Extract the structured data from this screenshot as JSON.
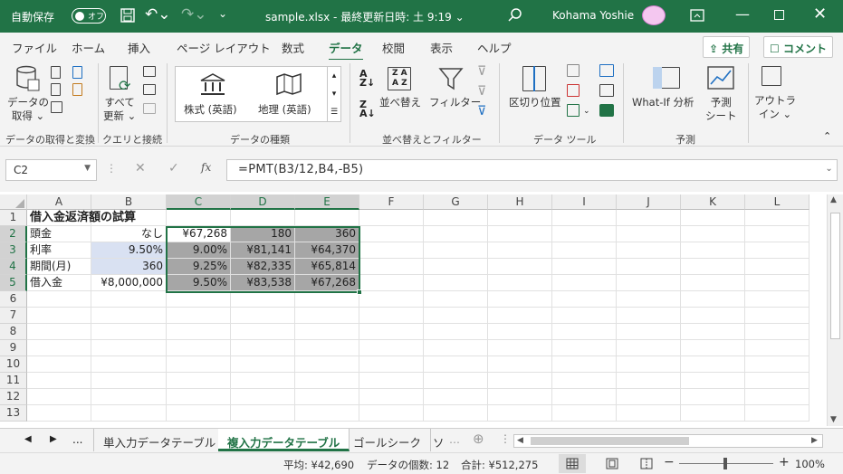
{
  "titlebar": {
    "autosave": "自動保存",
    "toggle": "オフ",
    "filename": "sample.xlsx - 最終更新日時: 土 9:19 ⌄",
    "user": "Kohama Yoshie",
    "colors": {
      "bg": "#217346"
    }
  },
  "menu": {
    "tabs": [
      "ファイル",
      "ホーム",
      "挿入",
      "ページ レイアウト",
      "数式",
      "データ",
      "校閲",
      "表示",
      "ヘルプ"
    ],
    "active": "データ",
    "share": "共有",
    "comment": "コメント"
  },
  "ribbon": {
    "get_data": "データの\n取得 ⌄",
    "refresh_all": "すべて\n更新 ⌄",
    "stocks": "株式 (英語)",
    "geography": "地理 (英語)",
    "sort": "並べ替え",
    "filter": "フィルター",
    "text_to_columns": "区切り位置",
    "whatif": "What-If 分析",
    "forecast": "予測\nシート",
    "outline": "アウトラ\nイン ⌄",
    "groups": [
      "データの取得と変換",
      "クエリと接続",
      "データの種類",
      "並べ替えとフィルター",
      "データ ツール",
      "予測"
    ]
  },
  "formulabar": {
    "namebox": "C2",
    "formula": "=PMT(B3/12,B4,-B5)",
    "fx": "fx"
  },
  "grid": {
    "columns": [
      "A",
      "B",
      "C",
      "D",
      "E",
      "F",
      "G",
      "H",
      "I",
      "J",
      "K",
      "L"
    ],
    "rows": [
      "1",
      "2",
      "3",
      "4",
      "5",
      "6",
      "7",
      "8",
      "9",
      "10",
      "11",
      "12",
      "13"
    ],
    "cells": {
      "A1": "借入金返済額の試算",
      "A2": "頭金",
      "B2": "なし",
      "C2": "¥67,268",
      "D2": "180",
      "E2": "360",
      "A3": "利率",
      "B3": "9.50%",
      "C3": "9.00%",
      "D3": "¥81,141",
      "E3": "¥64,370",
      "A4": "期間(月)",
      "B4": "360",
      "C4": "9.25%",
      "D4": "¥82,335",
      "E4": "¥65,814",
      "A5": "借入金",
      "B5": "¥8,000,000",
      "C5": "9.50%",
      "D5": "¥83,538",
      "E5": "¥67,268"
    }
  },
  "sheets": {
    "tabs": [
      "単入力データテーブル",
      "複入力データテーブル",
      "ゴールシーク",
      "ソ"
    ],
    "active": "複入力データテーブル",
    "ellipsis": "..."
  },
  "status": {
    "average": "平均: ¥42,690",
    "count": "データの個数: 12",
    "sum": "合計: ¥512,275",
    "zoom": "100%"
  }
}
